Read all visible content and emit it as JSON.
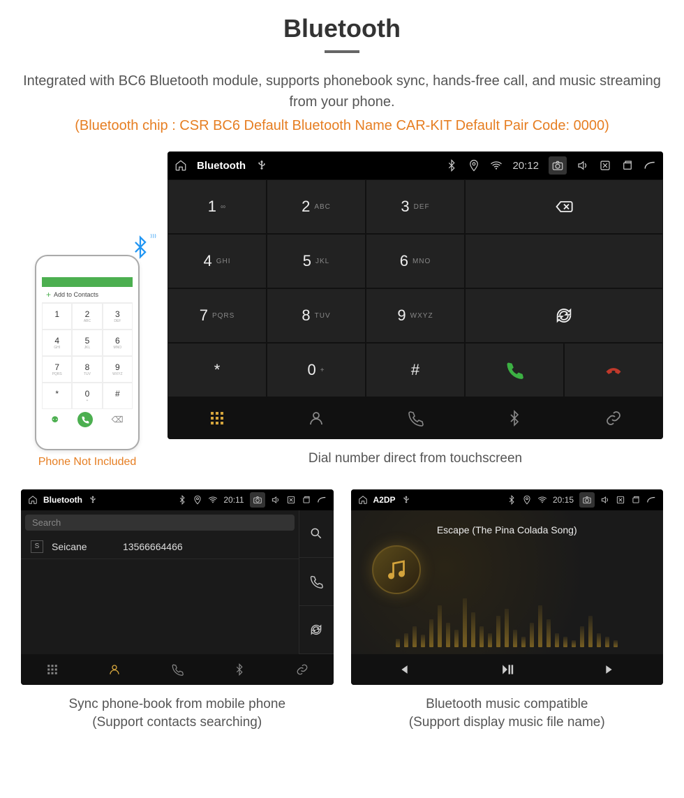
{
  "header": {
    "title": "Bluetooth",
    "subtitle": "Integrated with BC6 Bluetooth module, supports phonebook sync, hands-free call, and music streaming from your phone.",
    "spec_line": "(Bluetooth chip : CSR BC6     Default Bluetooth Name CAR-KIT     Default Pair Code: 0000)"
  },
  "phone_mock": {
    "add_label": "Add to Contacts",
    "keys": [
      "1",
      "2",
      "3",
      "4",
      "5",
      "6",
      "7",
      "8",
      "9",
      "*",
      "0",
      "#"
    ],
    "key_subs": {
      "2": "ABC",
      "3": "DEF",
      "4": "GHI",
      "5": "JKL",
      "6": "MNO",
      "7": "PQRS",
      "8": "TUV",
      "9": "WXYZ",
      "0": "+"
    },
    "caption": "Phone Not Included"
  },
  "dialer": {
    "statusbar": {
      "title": "Bluetooth",
      "time": "20:12"
    },
    "keypad": [
      {
        "d": "1",
        "s": "∞"
      },
      {
        "d": "2",
        "s": "ABC"
      },
      {
        "d": "3",
        "s": "DEF"
      },
      {
        "d": "4",
        "s": "GHI"
      },
      {
        "d": "5",
        "s": "JKL"
      },
      {
        "d": "6",
        "s": "MNO"
      },
      {
        "d": "7",
        "s": "PQRS"
      },
      {
        "d": "8",
        "s": "TUV"
      },
      {
        "d": "9",
        "s": "WXYZ"
      },
      {
        "d": "*",
        "s": ""
      },
      {
        "d": "0",
        "s": "+"
      },
      {
        "d": "#",
        "s": ""
      }
    ],
    "caption": "Dial number direct from touchscreen"
  },
  "contacts": {
    "statusbar": {
      "title": "Bluetooth",
      "time": "20:11"
    },
    "search_placeholder": "Search",
    "items": [
      {
        "badge": "S",
        "name": "Seicane",
        "number": "13566664466"
      }
    ],
    "caption_l1": "Sync phone-book from mobile phone",
    "caption_l2": "(Support contacts searching)"
  },
  "music": {
    "statusbar": {
      "title": "A2DP",
      "time": "20:15"
    },
    "track": "Escape (The Pina Colada Song)",
    "eq_heights": [
      12,
      20,
      30,
      18,
      40,
      60,
      35,
      25,
      70,
      50,
      30,
      20,
      45,
      55,
      25,
      15,
      35,
      60,
      40,
      20,
      15,
      10,
      30,
      45,
      20,
      15,
      10
    ],
    "caption_l1": "Bluetooth music compatible",
    "caption_l2": "(Support display music file name)"
  }
}
